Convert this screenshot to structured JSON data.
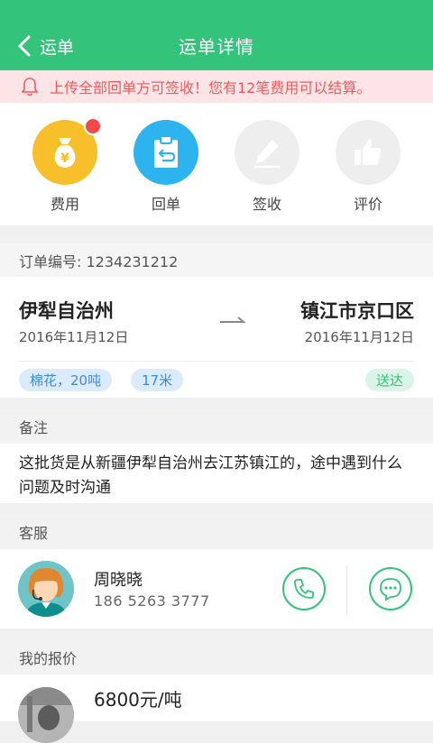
{
  "header": {
    "back_label": "运单",
    "title": "运单详情"
  },
  "notice": {
    "text": "上传全部回单方可签收！您有12笔费用可以结算。"
  },
  "actions": [
    {
      "label": "费用",
      "icon": "money-bag-icon",
      "color": "#f7bf2a",
      "badge": true
    },
    {
      "label": "回单",
      "icon": "receipt-return-icon",
      "color": "#2db4ef"
    },
    {
      "label": "签收",
      "icon": "pen-sign-icon",
      "color": "#eeeeee"
    },
    {
      "label": "评价",
      "icon": "thumbs-up-icon",
      "color": "#eeeeee"
    }
  ],
  "order": {
    "number_label": "订单编号: 1234231212"
  },
  "route": {
    "from_city": "伊犁自治州",
    "from_date": "2016年11月12日",
    "to_city": "镇江市京口区",
    "to_date": "2016年11月12日",
    "cargo_tag": "棉花，20吨",
    "length_tag": "17米",
    "delivery_tag": "送达"
  },
  "remark": {
    "label": "备注",
    "text": "这批货是从新疆伊犁自治州去江苏镇江的，途中遇到什么问题及时沟通"
  },
  "service": {
    "label": "客服",
    "name": "周晓晓",
    "phone": "186 5263 3777"
  },
  "quote": {
    "label": "我的报价",
    "price": "6800元/吨"
  },
  "colors": {
    "brand": "#34c37a",
    "alert": "#f15a5a",
    "tag_blue": "#3e8ad6"
  }
}
